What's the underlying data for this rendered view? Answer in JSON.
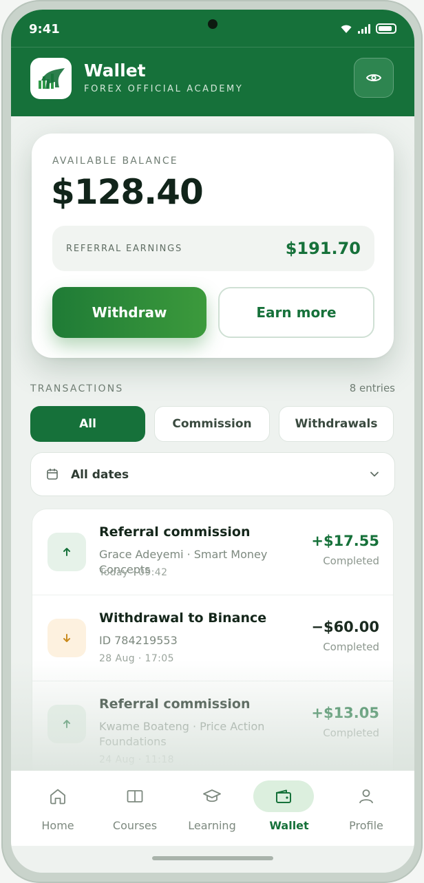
{
  "status_bar": {
    "time": "9:41"
  },
  "header": {
    "title": "Wallet",
    "subtitle": "FOREX OFFICIAL ACADEMY",
    "logo_icon": "bull-chart-logo",
    "eye_icon": "eye-icon"
  },
  "balance": {
    "label": "AVAILABLE BALANCE",
    "amount": "$128.40",
    "referral_label": "REFERRAL EARNINGS",
    "referral_amount": "$191.70",
    "withdraw_label": "Withdraw",
    "earn_label": "Earn more"
  },
  "transactions": {
    "label": "TRANSACTIONS",
    "count": "8 entries",
    "filters": [
      {
        "label": "All",
        "active": true
      },
      {
        "label": "Commission",
        "active": false
      },
      {
        "label": "Withdrawals",
        "active": false
      }
    ],
    "date_filter": "All dates",
    "items": [
      {
        "direction": "up",
        "title": "Referral commission",
        "desc": "Grace Adeyemi · Smart Money Concepts",
        "time": "Today · 09:42",
        "amount": "+$17.55",
        "status": "Completed"
      },
      {
        "direction": "down",
        "title": "Withdrawal to Binance",
        "desc": "ID 784219553",
        "time": "28 Aug · 17:05",
        "amount": "−$60.00",
        "status": "Completed"
      },
      {
        "direction": "up",
        "title": "Referral commission",
        "desc": "Kwame Boateng · Price Action Foundations",
        "time": "24 Aug · 11:18",
        "amount": "+$13.05",
        "status": "Completed"
      }
    ]
  },
  "nav": {
    "items": [
      {
        "label": "Home",
        "icon": "home-icon"
      },
      {
        "label": "Courses",
        "icon": "book-icon"
      },
      {
        "label": "Learning",
        "icon": "graduation-cap-icon"
      },
      {
        "label": "Wallet",
        "icon": "wallet-icon",
        "active": true
      },
      {
        "label": "Profile",
        "icon": "user-icon"
      }
    ]
  },
  "colors": {
    "brand": "#16713a",
    "positive": "#16713a",
    "withdraw_icon_bg": "#fdf1df",
    "commission_icon_bg": "#e6f2e9"
  }
}
